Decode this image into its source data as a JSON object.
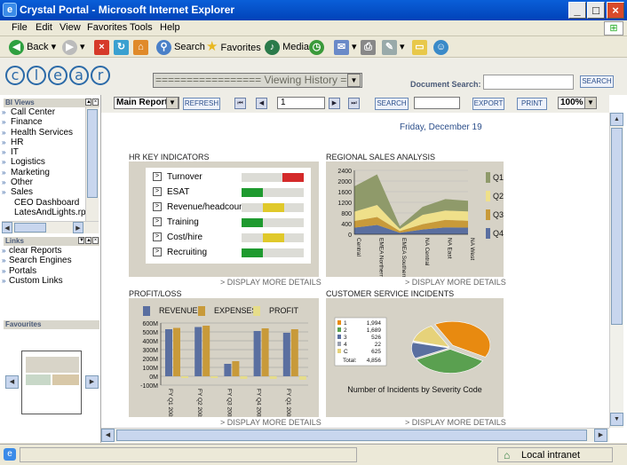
{
  "window": {
    "title": "Crystal Portal - Microsoft Internet Explorer"
  },
  "menu": [
    "File",
    "Edit",
    "View",
    "Favorites",
    "Tools",
    "Help"
  ],
  "toolbar": {
    "back": "Back",
    "search": "Search",
    "favorites": "Favorites",
    "media": "Media"
  },
  "header": {
    "logo_letters": [
      "c",
      "l",
      "e",
      "a",
      "r"
    ],
    "view_select": "================= Viewing History ==",
    "doc_search_label": "Document Search:",
    "doc_search_value": "",
    "search_button": "SEARCH"
  },
  "left": {
    "bi_views_title": "BI Views",
    "bi_views": [
      "Call Center",
      "Finance",
      "Health Services",
      "HR",
      "IT",
      "Logistics",
      "Marketing",
      "Other",
      "Sales"
    ],
    "bi_files": [
      "CEO Dashboard",
      "LatesAndLights.rpt"
    ],
    "links_title": "Links",
    "links": [
      "clear Reports",
      "Search Engines",
      "Portals",
      "Custom Links"
    ],
    "favourites_title": "Favourites"
  },
  "reportbar": {
    "report_select": "Main Report",
    "refresh": "REFRESH",
    "page": "1",
    "search": "SEARCH",
    "search_value": "",
    "export": "EXPORT",
    "print": "PRINT",
    "zoom": "100%"
  },
  "report": {
    "date": "Friday, December 19",
    "hr": {
      "title": "HR KEY INDICATORS",
      "rows": [
        {
          "label": "Turnover",
          "color": "#d42a2a",
          "level": "high"
        },
        {
          "label": "ESAT",
          "color": "#1f9a2f",
          "level": "low"
        },
        {
          "label": "Revenue/headcount",
          "color": "#e0c92a",
          "level": "mid"
        },
        {
          "label": "Training",
          "color": "#1f9a2f",
          "level": "low"
        },
        {
          "label": "Cost/hire",
          "color": "#e0c92a",
          "level": "mid"
        },
        {
          "label": "Recruiting",
          "color": "#1f9a2f",
          "level": "low"
        }
      ],
      "more": "> DISPLAY MORE DETAILS"
    },
    "regional": {
      "title": "REGIONAL SALES ANALYSIS",
      "more": "> DISPLAY MORE DETAILS"
    },
    "profit": {
      "title": "PROFIT/LOSS",
      "more": "> DISPLAY MORE DETAILS"
    },
    "incidents": {
      "title": "CUSTOMER SERVICE INCIDENTS",
      "caption": "Number of Incidents by Severity Code",
      "more": "> DISPLAY MORE DETAILS"
    }
  },
  "status": {
    "zone": "Local intranet"
  },
  "chart_data": [
    {
      "type": "area",
      "title": "REGIONAL SALES ANALYSIS",
      "categories": [
        "Central",
        "EMEA Northern",
        "EMEA Southern",
        "NA Central",
        "NA East",
        "NA West"
      ],
      "ylim": [
        0,
        2400
      ],
      "yticks": [
        0,
        400,
        800,
        1200,
        1600,
        2000,
        2400
      ],
      "series": [
        {
          "name": "Q4",
          "color": "#5a6fa0",
          "values": [
            250,
            350,
            60,
            180,
            260,
            250
          ]
        },
        {
          "name": "Q3",
          "color": "#c89a3a",
          "values": [
            250,
            300,
            60,
            200,
            280,
            260
          ]
        },
        {
          "name": "Q2",
          "color": "#efe08a",
          "values": [
            350,
            450,
            80,
            350,
            350,
            350
          ]
        },
        {
          "name": "Q1",
          "color": "#8f9a6a",
          "values": [
            950,
            1150,
            100,
            300,
            430,
            400
          ]
        }
      ]
    },
    {
      "type": "bar",
      "title": "PROFIT/LOSS",
      "categories": [
        "FY Q1 2002",
        "FY Q2 2002",
        "FY Q3 2002",
        "FY Q4 2002",
        "FY Q1 2003"
      ],
      "ylim": [
        -100,
        600
      ],
      "yticks": [
        -100,
        0,
        100,
        200,
        300,
        400,
        500,
        600
      ],
      "ytick_labels": [
        "-100M",
        "0M",
        "100M",
        "200M",
        "300M",
        "400M",
        "500M",
        "600M"
      ],
      "series": [
        {
          "name": "REVENUE",
          "color": "#5a6fa0",
          "values": [
            530,
            555,
            140,
            510,
            490
          ]
        },
        {
          "name": "EXPENSES",
          "color": "#c89a3a",
          "values": [
            545,
            570,
            170,
            540,
            530
          ]
        },
        {
          "name": "PROFIT",
          "color": "#e6dd8a",
          "values": [
            -20,
            -20,
            -30,
            -30,
            -40
          ]
        }
      ]
    },
    {
      "type": "pie",
      "title": "Number of Incidents by Severity Code",
      "slices": [
        {
          "label": "1",
          "value": 1994,
          "display": "1,994",
          "color": "#e88a10"
        },
        {
          "label": "2",
          "value": 1689,
          "display": "1,689",
          "color": "#5aa050"
        },
        {
          "label": "3",
          "value": 526,
          "display": "526",
          "color": "#5a6fa0"
        },
        {
          "label": "4",
          "value": 22,
          "display": "22",
          "color": "#9aa0b0"
        },
        {
          "label": "C",
          "value": 625,
          "display": "625",
          "color": "#e6d27a"
        }
      ],
      "total_label": "Total:",
      "total": "4,856"
    }
  ]
}
